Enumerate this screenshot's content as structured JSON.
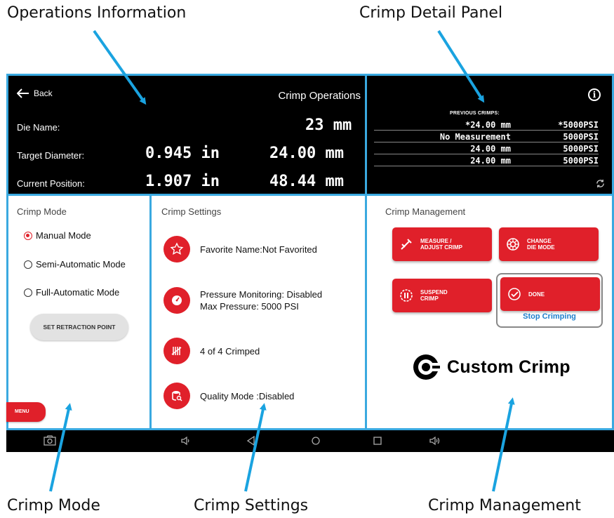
{
  "callouts": {
    "operations_info": "Operations Information",
    "detail_panel": "Crimp Detail Panel",
    "crimp_mode": "Crimp Mode",
    "crimp_settings": "Crimp Settings",
    "crimp_management": "Crimp Management"
  },
  "operations": {
    "back_label": "Back",
    "title": "Crimp Operations",
    "die_name_label": "Die Name:",
    "die_name_value": "23 mm",
    "target_label": "Target Diameter:",
    "target_in": "0.945 in",
    "target_mm": "24.00 mm",
    "position_label": "Current Position:",
    "position_in": "1.907 in",
    "position_mm": "48.44 mm"
  },
  "detail": {
    "info_icon": "info-icon",
    "header": "PREVIOUS CRIMPS:",
    "rows": [
      {
        "a": "*24.00 mm",
        "b": "*5000PSI"
      },
      {
        "a": "No Measurement",
        "b": "5000PSI"
      },
      {
        "a": "24.00 mm",
        "b": "5000PSI"
      },
      {
        "a": "24.00 mm",
        "b": "5000PSI"
      }
    ],
    "refresh_icon": "refresh-icon"
  },
  "mode": {
    "title": "Crimp Mode",
    "options": [
      "Manual Mode",
      "Semi-Automatic Mode",
      "Full-Automatic Mode"
    ],
    "selected": "Manual Mode",
    "retract_label": "SET RETRACTION POINT",
    "menu_label": "MENU"
  },
  "settings": {
    "title": "Crimp Settings",
    "favorite": "Favorite Name:Not Favorited",
    "pressure_line1": "Pressure Monitoring: Disabled",
    "pressure_line2": "Max Pressure: 5000 PSI",
    "count": "4 of 4 Crimped",
    "quality": "Quality Mode :Disabled"
  },
  "management": {
    "title": "Crimp Management",
    "measure_label_1": "MEASURE /",
    "measure_label_2": "ADJUST CRIMP",
    "change_label_1": "CHANGE",
    "change_label_2": "DIE MODE",
    "suspend_label_1": "SUSPEND",
    "suspend_label_2": "CRIMP",
    "done_label": "DONE",
    "stop_label": "Stop Crimping",
    "logo_text": "Custom Crimp"
  },
  "colors": {
    "accent_red": "#e0202a",
    "panel_border": "#3aa9e0",
    "link_blue": "#1d7fcc",
    "dark_bg": "#000000"
  }
}
